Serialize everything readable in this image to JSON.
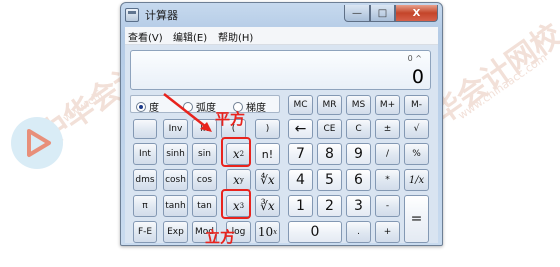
{
  "watermark": {
    "text_cn_left": "中华会计",
    "text_url_left": "www.chi",
    "text_cn_right": "华会计网校",
    "text_url_right": "www.chinaacc.com"
  },
  "window": {
    "title": "计算器",
    "controls": {
      "minimize": "—",
      "maximize": "□",
      "close": "X"
    }
  },
  "menu": [
    "查看(V)",
    "编辑(E)",
    "帮助(H)"
  ],
  "display": {
    "memory_line": "0 ^",
    "value": "0"
  },
  "angle_modes": [
    {
      "label": "度",
      "selected": true
    },
    {
      "label": "弧度",
      "selected": false
    },
    {
      "label": "梯度",
      "selected": false
    }
  ],
  "buttons": {
    "mc": "MC",
    "mr": "MR",
    "ms": "MS",
    "mplus": "M+",
    "mminus": "M-",
    "inv": "Inv",
    "ln": "ln",
    "lparen": "(",
    "rparen": ")",
    "back": "←",
    "ce": "CE",
    "c": "C",
    "plusminus": "±",
    "sqrt": "√",
    "int": "Int",
    "sinh": "sinh",
    "sin": "sin",
    "sq_base": "x",
    "sq_exp": "2",
    "fact": "n!",
    "n7": "7",
    "n8": "8",
    "n9": "9",
    "div": "/",
    "pct": "%",
    "dms": "dms",
    "cosh": "cosh",
    "cos": "cos",
    "pow_base": "x",
    "pow_exp": "y",
    "yroot": "∜x",
    "n4": "4",
    "n5": "5",
    "n6": "6",
    "mul": "*",
    "recip": "1/x",
    "pi": "π",
    "tanh": "tanh",
    "tan": "tan",
    "cube_base": "x",
    "cube_exp": "3",
    "croot": "∛x",
    "n1": "1",
    "n2": "2",
    "n3": "3",
    "minus": "-",
    "equals": "=",
    "fe": "F-E",
    "exp": "Exp",
    "mod": "Mod",
    "log": "log",
    "tenx_base": "10",
    "tenx_exp": "x",
    "n0": "0",
    "dot": ".",
    "plus": "+"
  },
  "annotations": {
    "square": "平方",
    "cube": "立方"
  },
  "colors": {
    "annotation": "#e8231d",
    "window_frame": "#b4cbe6",
    "close_button": "#c4452a"
  }
}
